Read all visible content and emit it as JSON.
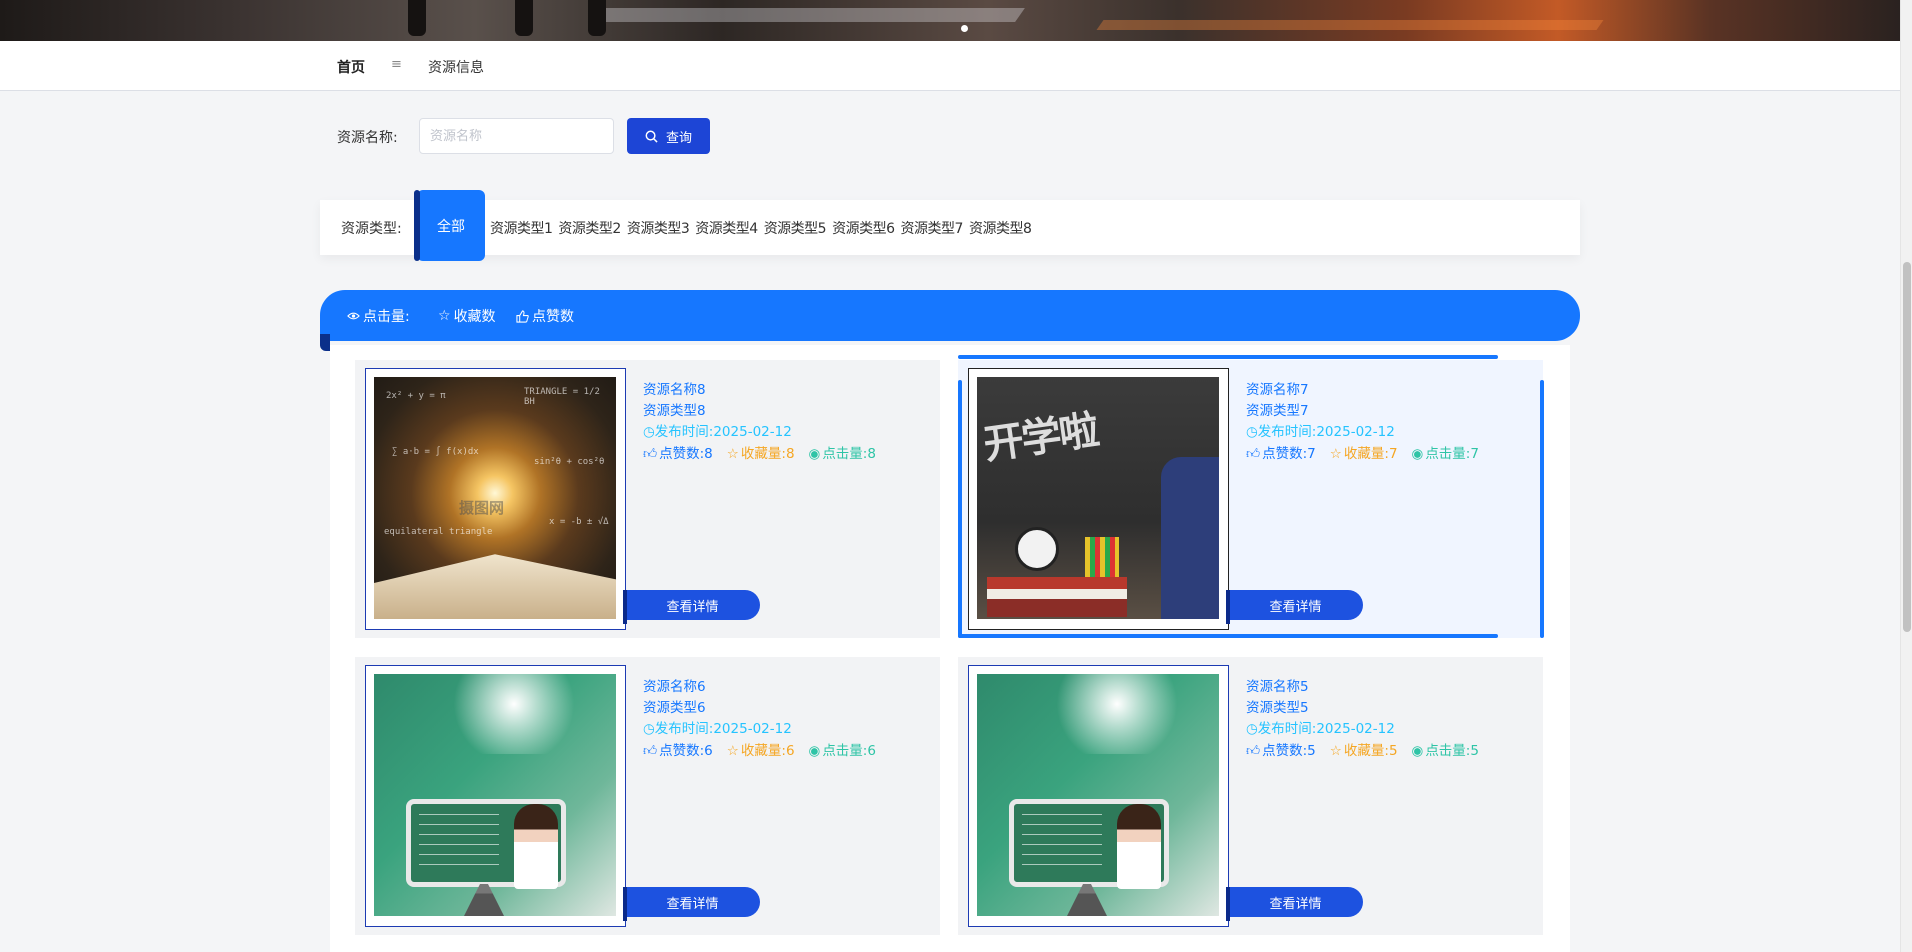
{
  "nav": {
    "home": "首页",
    "separator": "≡",
    "current": "资源信息"
  },
  "search": {
    "label": "资源名称:",
    "placeholder": "资源名称",
    "button_label": "查询"
  },
  "types": {
    "label": "资源类型:",
    "active": "全部",
    "items": [
      "资源类型1",
      "资源类型2",
      "资源类型3",
      "资源类型4",
      "资源类型5",
      "资源类型6",
      "资源类型7",
      "资源类型8"
    ]
  },
  "sort": {
    "clicks": "点击量:",
    "favorites": "收藏数",
    "likes": "点赞数"
  },
  "cards": [
    {
      "name": "资源名称8",
      "type": "资源类型8",
      "date_label": "发布时间:",
      "date": "2025-02-12",
      "like_label": "点赞数:",
      "likes": "8",
      "fav_label": "收藏量:",
      "favs": "8",
      "view_label": "点击量:",
      "views": "8",
      "button": "查看详情",
      "image": "book-formula"
    },
    {
      "name": "资源名称7",
      "type": "资源类型7",
      "date_label": "发布时间:",
      "date": "2025-02-12",
      "like_label": "点赞数:",
      "likes": "7",
      "fav_label": "收藏量:",
      "favs": "7",
      "view_label": "点击量:",
      "views": "7",
      "button": "查看详情",
      "image": "back-to-school"
    },
    {
      "name": "资源名称6",
      "type": "资源类型6",
      "date_label": "发布时间:",
      "date": "2025-02-12",
      "like_label": "点赞数:",
      "likes": "6",
      "fav_label": "收藏量:",
      "favs": "6",
      "view_label": "点击量:",
      "views": "6",
      "button": "查看详情",
      "image": "teacher-classroom"
    },
    {
      "name": "资源名称5",
      "type": "资源类型5",
      "date_label": "发布时间:",
      "date": "2025-02-12",
      "like_label": "点赞数:",
      "likes": "5",
      "fav_label": "收藏量:",
      "favs": "5",
      "view_label": "点击量:",
      "views": "5",
      "button": "查看详情",
      "image": "teacher-classroom"
    }
  ],
  "images": {
    "book": {
      "watermark": "摄图网"
    },
    "school": {
      "chalk": "开学啦"
    }
  },
  "colors": {
    "primary": "#1677ff",
    "dark_accent": "#1d45d6",
    "fav": "#f5a623",
    "view": "#2ec4a6",
    "date": "#25c3ff"
  }
}
